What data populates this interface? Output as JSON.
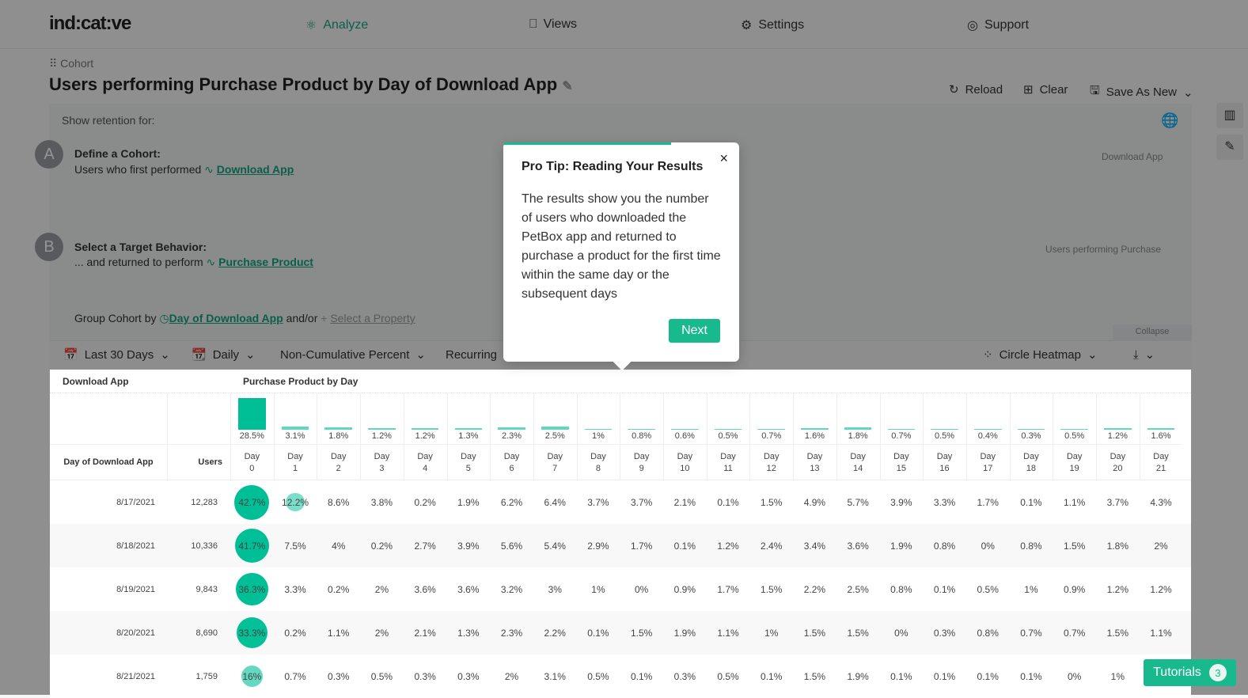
{
  "nav": {
    "logo": "ind:cat:ve",
    "items": [
      {
        "label": "Analyze",
        "icon": "atom-icon",
        "active": true
      },
      {
        "label": "Views",
        "icon": "bookmark-icon"
      },
      {
        "label": "Settings",
        "icon": "gear-icon"
      },
      {
        "label": "Support",
        "icon": "lifebuoy-icon"
      }
    ]
  },
  "header": {
    "breadcrumb": "Cohort",
    "title": "Users performing Purchase Product by Day of Download App",
    "actions": {
      "reload": "Reload",
      "clear": "Clear",
      "save": "Save As New"
    }
  },
  "query": {
    "show_retention": "Show retention for:",
    "a_badge": "A",
    "a_title": "Define a Cohort:",
    "a_text": "Users who first performed",
    "a_event": "Download App",
    "a_right": "Download App",
    "b_badge": "B",
    "b_title": "Select a Target Behavior:",
    "b_text": "... and returned to perform",
    "b_event": "Purchase Product",
    "b_right": "Users performing Purchase",
    "group_label": "Group Cohort by",
    "group_value": "Day of Download App",
    "andor": "and/or",
    "select_prop": "Select a Property",
    "collapse": "Collapse"
  },
  "toolbar": {
    "range": "Last 30 Days",
    "interval": "Daily",
    "mode": "Non-Cumulative Percent",
    "type": "Recurring",
    "viz": "Circle Heatmap"
  },
  "tooltip": {
    "title": "Pro Tip: Reading Your Results",
    "body": "The results show you the number of users who downloaded the PetBox app and returned to purchase a product for the first time within the same day or the subsequent days",
    "next": "Next"
  },
  "tutorials": {
    "label": "Tutorials",
    "count": "3"
  },
  "table": {
    "col1": "Download App",
    "col2": "Purchase Product by Day",
    "row_header": "Day of Download App",
    "users_header": "Users",
    "day_label": "Day",
    "summary": [
      "28.5%",
      "3.1%",
      "1.8%",
      "1.2%",
      "1.2%",
      "1.3%",
      "2.3%",
      "2.5%",
      "1%",
      "0.8%",
      "0.6%",
      "0.5%",
      "0.7%",
      "1.6%",
      "1.8%",
      "0.7%",
      "0.5%",
      "0.4%",
      "0.3%",
      "0.5%",
      "1.2%",
      "1.6%"
    ],
    "rows": [
      {
        "date": "8/17/2021",
        "users": "12,283",
        "values": [
          "42.7%",
          "12.2%",
          "8.6%",
          "3.8%",
          "0.2%",
          "1.9%",
          "6.2%",
          "6.4%",
          "3.7%",
          "3.7%",
          "2.1%",
          "0.1%",
          "1.5%",
          "4.9%",
          "5.7%",
          "3.9%",
          "3.3%",
          "1.7%",
          "0.1%",
          "1.1%",
          "3.7%",
          "4.3%"
        ]
      },
      {
        "date": "8/18/2021",
        "users": "10,336",
        "values": [
          "41.7%",
          "7.5%",
          "4%",
          "0.2%",
          "2.7%",
          "3.9%",
          "5.6%",
          "5.4%",
          "2.9%",
          "1.7%",
          "0.1%",
          "1.2%",
          "2.4%",
          "3.4%",
          "3.6%",
          "1.9%",
          "0.8%",
          "0%",
          "0.8%",
          "1.5%",
          "1.8%",
          "2%"
        ]
      },
      {
        "date": "8/19/2021",
        "users": "9,843",
        "values": [
          "36.3%",
          "3.3%",
          "0.2%",
          "2%",
          "3.6%",
          "3.6%",
          "3.2%",
          "3%",
          "1%",
          "0%",
          "0.9%",
          "1.7%",
          "1.5%",
          "2.2%",
          "2.5%",
          "0.8%",
          "0.1%",
          "0.5%",
          "1%",
          "0.9%",
          "1.2%",
          "1.2%"
        ]
      },
      {
        "date": "8/20/2021",
        "users": "8,690",
        "values": [
          "33.3%",
          "0.2%",
          "1.1%",
          "2%",
          "2.1%",
          "1.3%",
          "2.3%",
          "2.2%",
          "0.1%",
          "1.5%",
          "1.9%",
          "1.1%",
          "1%",
          "1.5%",
          "1.5%",
          "0%",
          "0.3%",
          "0.8%",
          "0.7%",
          "0.7%",
          "1.5%",
          "1.1%"
        ]
      },
      {
        "date": "8/21/2021",
        "users": "1,759",
        "values": [
          "16%",
          "0.7%",
          "0.3%",
          "0.5%",
          "0.3%",
          "0.3%",
          "2%",
          "3.1%",
          "0.5%",
          "0.1%",
          "0.3%",
          "0.5%",
          "0.1%",
          "1.5%",
          "1.9%",
          "0.1%",
          "0.1%",
          "0.1%",
          "0.1%",
          "0%",
          "1%",
          ""
        ]
      }
    ]
  },
  "colors": {
    "accent": "#19b98e",
    "heat": "#00bf96"
  }
}
